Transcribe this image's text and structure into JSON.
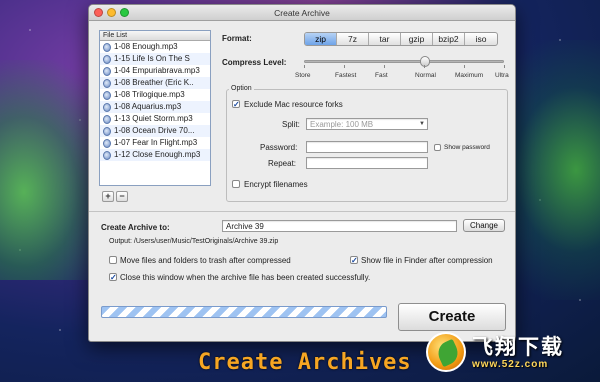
{
  "window": {
    "title": "Create Archive"
  },
  "file_list": {
    "header": "File List",
    "items": [
      "1-08 Enough.mp3",
      "1-15 Life Is On The S",
      "1-04 Empuriabrava.mp3",
      "1-08 Breather (Eric K..",
      "1-08 Trilogique.mp3",
      "1-08 Aquarius.mp3",
      "1-13 Quiet Storm.mp3",
      "1-08 Ocean Drive 70...",
      "1-07 Fear In Flight.mp3",
      "1-12 Close Enough.mp3"
    ],
    "add_label": "+",
    "remove_label": "−"
  },
  "format": {
    "label": "Format:",
    "options": [
      "zip",
      "7z",
      "tar",
      "gzip",
      "bzip2",
      "iso"
    ],
    "selected": "zip"
  },
  "compress": {
    "label": "Compress Level:",
    "levels": [
      "Store",
      "Fastest",
      "Fast",
      "Normal",
      "Maximum",
      "Ultra"
    ],
    "selected": "Normal"
  },
  "options": {
    "title": "Option",
    "exclude_forks_label": "Exclude Mac resource forks",
    "exclude_forks_checked": true,
    "split_label": "Split:",
    "split_placeholder": "Example: 100 MB",
    "password_label": "Password:",
    "repeat_label": "Repeat:",
    "show_password_label": "Show password",
    "encrypt_label": "Encrypt filenames"
  },
  "output": {
    "create_to_label": "Create Archive to:",
    "archive_name": "Archive 39",
    "change_label": "Change",
    "output_path": "Output:  /Users/user/Music/TestOriginals/Archive 39.zip",
    "move_trash_label": "Move files and folders to trash after compressed",
    "show_finder_label": "Show file in Finder after compression",
    "close_window_label": "Close this window when the archive file has been created successfully.",
    "create_label": "Create"
  },
  "caption": "Create Archives",
  "brand": {
    "name": "飞翔下载",
    "url": "www.52z.com"
  }
}
